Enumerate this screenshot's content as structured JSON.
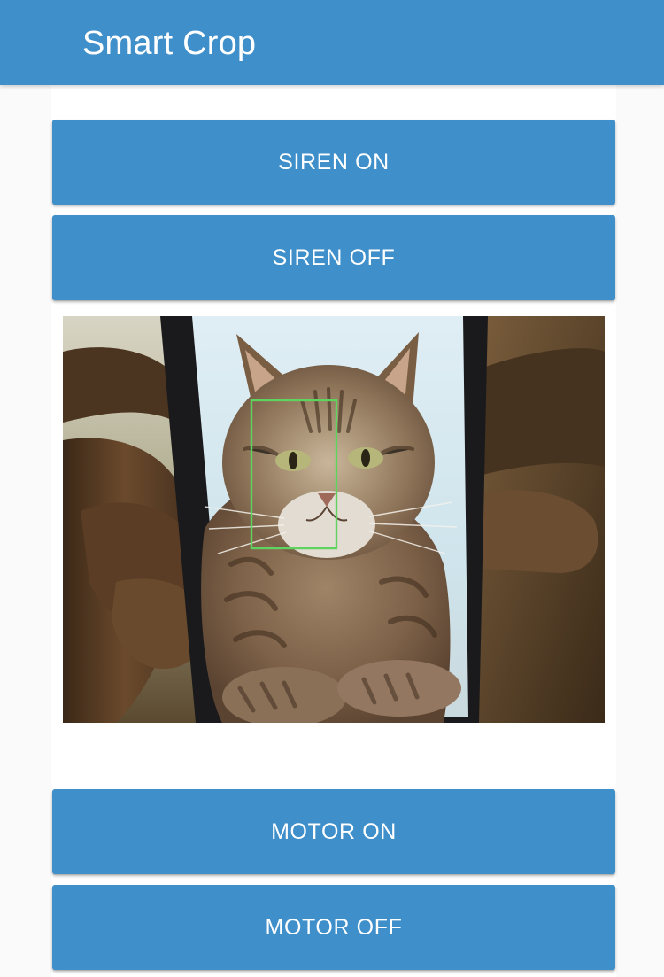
{
  "app_bar": {
    "title": "Smart Crop"
  },
  "buttons": {
    "siren_on": "SIREN ON",
    "siren_off": "SIREN OFF",
    "motor_on": "MOTOR ON",
    "motor_off": "MOTOR OFF"
  },
  "camera": {
    "subject": "cat photo on phone screen",
    "detection_box_color": "#5fd35f"
  },
  "colors": {
    "brand": "#3f8fca",
    "background": "#fafafa",
    "card": "#ffffff",
    "button_text": "#ffffff"
  }
}
